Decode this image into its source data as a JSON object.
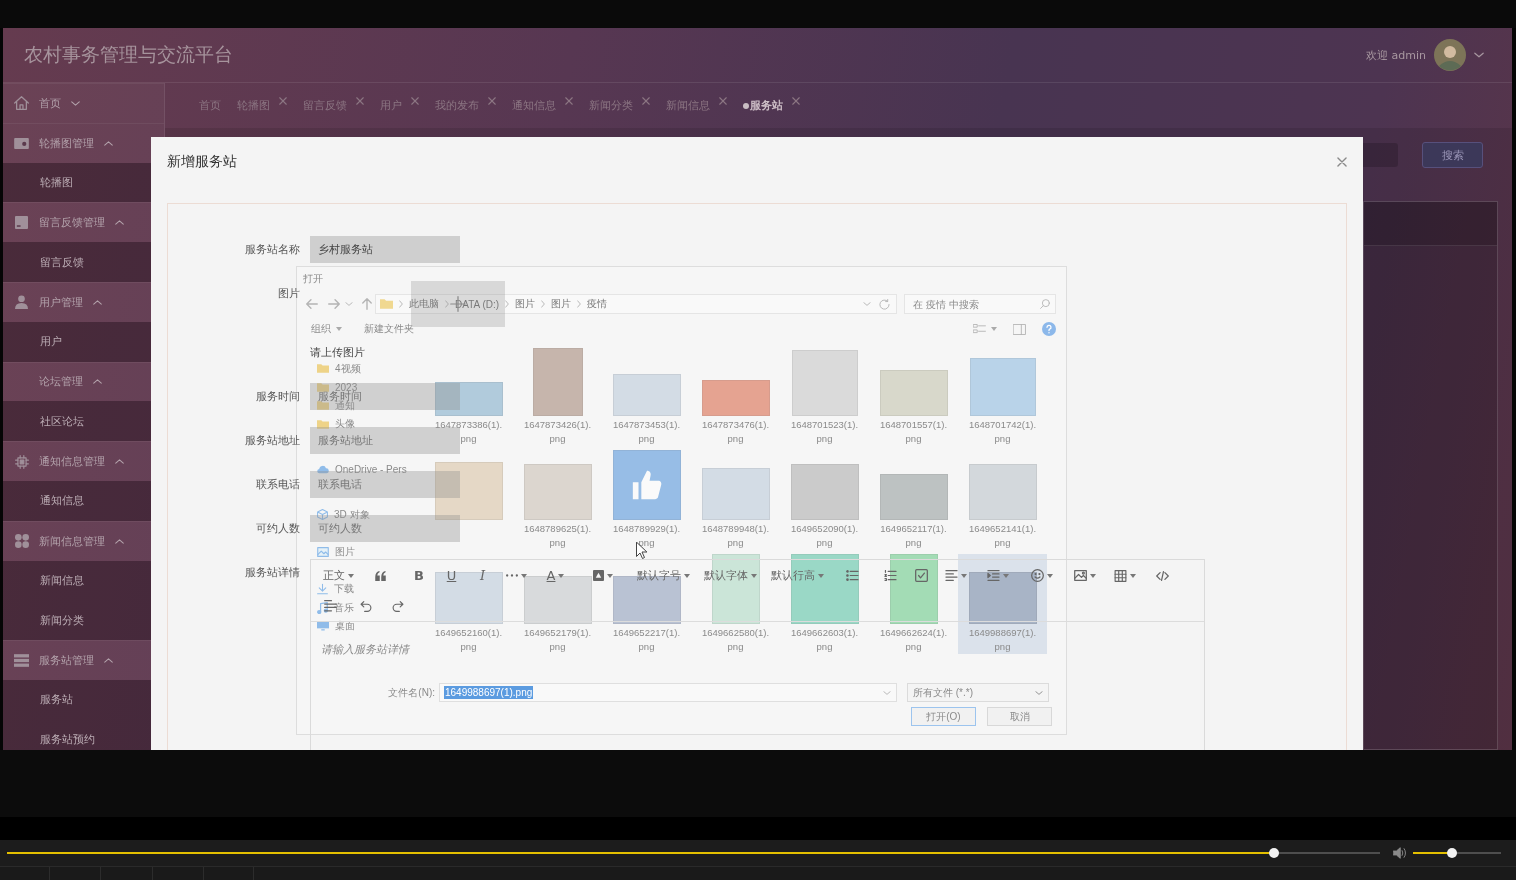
{
  "app": {
    "title": "农村事务管理与交流平台",
    "greeting": "欢迎 admin"
  },
  "sidebar": {
    "items": [
      {
        "label": "首页",
        "expanded": false
      },
      {
        "label": "轮播图管理",
        "expanded": true,
        "children": [
          {
            "label": "轮播图"
          }
        ]
      },
      {
        "label": "留言反馈管理",
        "expanded": true,
        "children": [
          {
            "label": "留言反馈"
          }
        ]
      },
      {
        "label": "用户管理",
        "expanded": true,
        "children": [
          {
            "label": "用户"
          }
        ]
      },
      {
        "label": "论坛管理",
        "expanded": true,
        "children": [
          {
            "label": "社区论坛"
          }
        ]
      },
      {
        "label": "通知信息管理",
        "expanded": true,
        "children": [
          {
            "label": "通知信息"
          }
        ]
      },
      {
        "label": "新闻信息管理",
        "expanded": true,
        "children": [
          {
            "label": "新闻信息"
          },
          {
            "label": "新闻分类"
          }
        ]
      },
      {
        "label": "服务站管理",
        "expanded": true,
        "children": [
          {
            "label": "服务站"
          },
          {
            "label": "服务站预约"
          }
        ]
      }
    ]
  },
  "tabs": [
    {
      "label": "首页",
      "closable": false,
      "selected": false
    },
    {
      "label": "轮播图",
      "closable": true,
      "selected": false
    },
    {
      "label": "留言反馈",
      "closable": true,
      "selected": false
    },
    {
      "label": "用户",
      "closable": true,
      "selected": false
    },
    {
      "label": "我的发布",
      "closable": true,
      "selected": false
    },
    {
      "label": "通知信息",
      "closable": true,
      "selected": false
    },
    {
      "label": "新闻分类",
      "closable": true,
      "selected": false
    },
    {
      "label": "新闻信息",
      "closable": true,
      "selected": false
    },
    {
      "label": "服务站",
      "closable": true,
      "selected": true
    }
  ],
  "page_search": {
    "button": "搜索"
  },
  "modal": {
    "title": "新增服务站",
    "form": {
      "fields": [
        {
          "kind": "text",
          "label": "服务站名称",
          "value": "乡村服务站"
        },
        {
          "kind": "upload",
          "label": "图片",
          "hint": "请上传图片"
        },
        {
          "kind": "text",
          "label": "服务时间",
          "placeholder": "服务时间"
        },
        {
          "kind": "text",
          "label": "服务站地址",
          "placeholder": "服务站地址"
        },
        {
          "kind": "text",
          "label": "联系电话",
          "placeholder": "联系电话"
        },
        {
          "kind": "text",
          "label": "可约人数",
          "placeholder": "可约人数"
        },
        {
          "kind": "editor",
          "label": "服务站详情",
          "placeholder": "请输入服务站详情",
          "toolbar": [
            [
              {
                "kind": "select",
                "label": "正文",
                "dropdown": true
              },
              {
                "kind": "icon",
                "dropdown": false
              },
              {
                "kind": "glyph",
                "label": "B",
                "dropdown": false
              },
              {
                "kind": "glyph",
                "label": "U",
                "dropdown": false
              },
              {
                "kind": "glyph",
                "label": "I",
                "dropdown": false
              },
              {
                "kind": "icon",
                "dropdown": true
              },
              {
                "kind": "glyph",
                "label": "A",
                "dropdown": true
              },
              {
                "kind": "icon",
                "dropdown": true
              },
              {
                "kind": "select",
                "label": "默认字号",
                "dropdown": true
              },
              {
                "kind": "select",
                "label": "默认字体",
                "dropdown": true
              },
              {
                "kind": "select",
                "label": "默认行高",
                "dropdown": true
              },
              {
                "kind": "icon",
                "dropdown": false
              },
              {
                "kind": "icon",
                "dropdown": false
              },
              {
                "kind": "icon",
                "dropdown": false
              },
              {
                "kind": "icon",
                "dropdown": true
              },
              {
                "kind": "icon",
                "dropdown": true
              },
              {
                "kind": "icon",
                "dropdown": true
              },
              {
                "kind": "icon",
                "dropdown": true
              },
              {
                "kind": "icon",
                "dropdown": true
              },
              {
                "kind": "icon",
                "dropdown": false
              }
            ],
            [
              {
                "kind": "icon",
                "dropdown": false
              },
              {
                "kind": "icon",
                "dropdown": false
              },
              {
                "kind": "icon",
                "dropdown": false
              }
            ]
          ]
        }
      ]
    }
  },
  "file_dialog": {
    "title": "打开",
    "breadcrumb": [
      "此电脑",
      "DATA (D:)",
      "图片",
      "图片",
      "疫情"
    ],
    "search": {
      "placeholder": "在 疫情 中搜索"
    },
    "commands": [
      {
        "label": "组织",
        "dropdown": true
      },
      {
        "label": "新建文件夹",
        "dropdown": false
      }
    ],
    "nav": [
      {
        "kind": "item",
        "label": "4视频"
      },
      {
        "kind": "item",
        "label": "2023"
      },
      {
        "kind": "item",
        "label": "通知"
      },
      {
        "kind": "item",
        "label": "头像"
      },
      {
        "kind": "section",
        "label": "OneDrive - Pers"
      },
      {
        "kind": "item",
        "label": "3D 对象"
      },
      {
        "kind": "item",
        "label": "图片"
      },
      {
        "kind": "item",
        "label": "下载"
      },
      {
        "kind": "item",
        "label": "音乐"
      },
      {
        "kind": "item",
        "label": "桌面"
      }
    ],
    "files": [
      {
        "name": "1647873386(1).png",
        "selected": false
      },
      {
        "name": "1647873426(1).png",
        "selected": false
      },
      {
        "name": "1647873453(1).png",
        "selected": false
      },
      {
        "name": "1647873476(1).png",
        "selected": false
      },
      {
        "name": "1648701523(1).png",
        "selected": false
      },
      {
        "name": "1648701557(1).png",
        "selected": false
      },
      {
        "name": "1648701742(1).png",
        "selected": false
      },
      {
        "selected": false
      },
      {
        "name": "1648789625(1).png",
        "selected": false
      },
      {
        "name": "1648789929(1).png",
        "selected": false
      },
      {
        "name": "1648789948(1).png",
        "selected": false
      },
      {
        "name": "1649652090(1).png",
        "selected": false
      },
      {
        "name": "1649652117(1).png",
        "selected": false
      },
      {
        "name": "1649652141(1).png",
        "selected": false
      },
      {
        "name": "1649652160(1).png",
        "selected": false
      },
      {
        "name": "1649652179(1).png",
        "selected": false
      },
      {
        "name": "1649652217(1).png",
        "selected": false
      },
      {
        "name": "1649662580(1).png",
        "selected": false
      },
      {
        "name": "1649662603(1).png",
        "selected": false
      },
      {
        "name": "1649662624(1).png",
        "selected": false
      },
      {
        "name": "1649988697(1).png",
        "selected": true
      }
    ],
    "filename": {
      "label": "文件名(N):",
      "value": "1649988697(1).png",
      "selected": true
    },
    "file_type": "所有文件 (*.*)",
    "buttons": [
      {
        "label": "打开(O)",
        "default": true
      },
      {
        "label": "取消",
        "default": false
      }
    ]
  },
  "player": {
    "seek": {
      "level": 0.923
    },
    "volume": {
      "level": 0.44
    }
  }
}
